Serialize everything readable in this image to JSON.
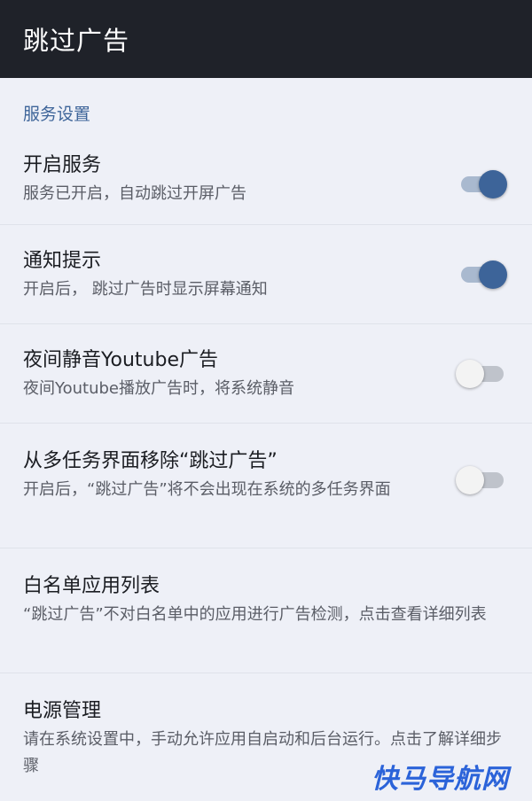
{
  "header": {
    "title": "跳过广告"
  },
  "section": {
    "title": "服务设置"
  },
  "settings": [
    {
      "title": "开启服务",
      "subtitle": "服务已开启，自动跳过开屏广告",
      "enabled": true
    },
    {
      "title": "通知提示",
      "subtitle": "开启后， 跳过广告时显示屏幕通知",
      "enabled": true
    },
    {
      "title": "夜间静音Youtube广告",
      "subtitle": "夜间Youtube播放广告时，将系统静音",
      "enabled": false
    },
    {
      "title": "从多任务界面移除“跳过广告”",
      "subtitle": "开启后，“跳过广告”将不会出现在系统的多任务界面",
      "enabled": false
    },
    {
      "title": "白名单应用列表",
      "subtitle": "“跳过广告”不对白名单中的应用进行广告检测，点击查看详细列表"
    },
    {
      "title": "电源管理",
      "subtitle": "请在系统设置中，手动允许应用自启动和后台运行。点击了解详细步骤"
    }
  ],
  "watermark": "快马导航网",
  "colors": {
    "accent": "#3d6499",
    "topbar": "#1f2229",
    "background": "#eef0f7",
    "watermark": "#2b63d9"
  }
}
